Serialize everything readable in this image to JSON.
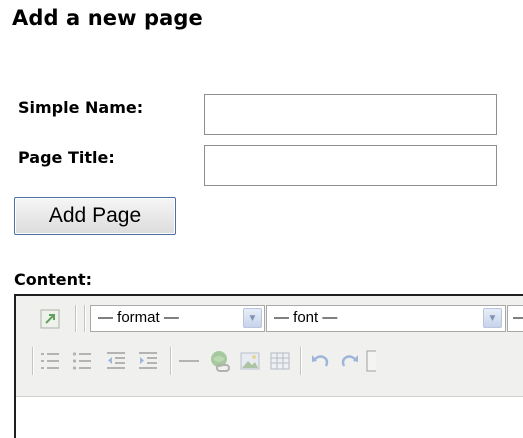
{
  "page": {
    "title": "Add a new page"
  },
  "form": {
    "simple_name_label": "Simple Name:",
    "simple_name_value": "",
    "page_title_label": "Page Title:",
    "page_title_value": "",
    "add_button_label": "Add Page",
    "content_label": "Content:"
  },
  "editor": {
    "format_select": "— format —",
    "font_select": "— font —",
    "third_select": "—",
    "icons": [
      "popout-icon",
      "ordered-list-icon",
      "unordered-list-icon",
      "outdent-icon",
      "indent-icon",
      "horizontal-rule-icon",
      "link-icon",
      "image-icon",
      "table-icon",
      "undo-icon",
      "redo-icon"
    ]
  },
  "colors": {
    "toolbar_bg": "#f0f0ee",
    "button_border": "#4f6fa0",
    "dropdown_arrow": "#c6d4ea"
  }
}
